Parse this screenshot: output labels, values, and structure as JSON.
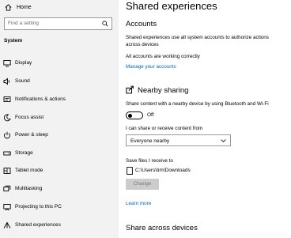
{
  "sidebar": {
    "home_label": "Home",
    "search_placeholder": "Find a setting",
    "section_title": "System",
    "items": [
      {
        "label": "Display",
        "icon": "display-icon"
      },
      {
        "label": "Sound",
        "icon": "sound-icon"
      },
      {
        "label": "Notifications & actions",
        "icon": "notifications-icon"
      },
      {
        "label": "Focus assist",
        "icon": "focus-assist-icon"
      },
      {
        "label": "Power & sleep",
        "icon": "power-icon"
      },
      {
        "label": "Storage",
        "icon": "storage-icon"
      },
      {
        "label": "Tablet mode",
        "icon": "tablet-mode-icon"
      },
      {
        "label": "Multitasking",
        "icon": "multitasking-icon"
      },
      {
        "label": "Projecting to this PC",
        "icon": "projecting-icon"
      },
      {
        "label": "Shared experiences",
        "icon": "shared-experiences-icon"
      }
    ]
  },
  "main": {
    "title": "Shared experiences",
    "accounts": {
      "heading": "Accounts",
      "desc_line1": "Shared experiences use all system accounts to authorize actions",
      "desc_line2": "across devices",
      "status": "All accounts are working correctly",
      "manage_link": "Manage your accounts"
    },
    "nearby": {
      "heading": "Nearby sharing",
      "desc": "Share content with a nearby device by using Bluetooth and Wi-Fi",
      "toggle_state": "Off",
      "share_from_label": "I can share or receive content from",
      "share_from_value": "Everyone nearby",
      "save_label": "Save files I receive to",
      "save_path": "C:\\Users\\tim\\Downloads",
      "change_button": "Change",
      "learn_more": "Learn more"
    },
    "share_across_heading": "Share across devices"
  },
  "colors": {
    "accent_link": "#0067b8",
    "sidebar_bg": "#f2f2f2",
    "button_disabled": "#cccccc"
  }
}
